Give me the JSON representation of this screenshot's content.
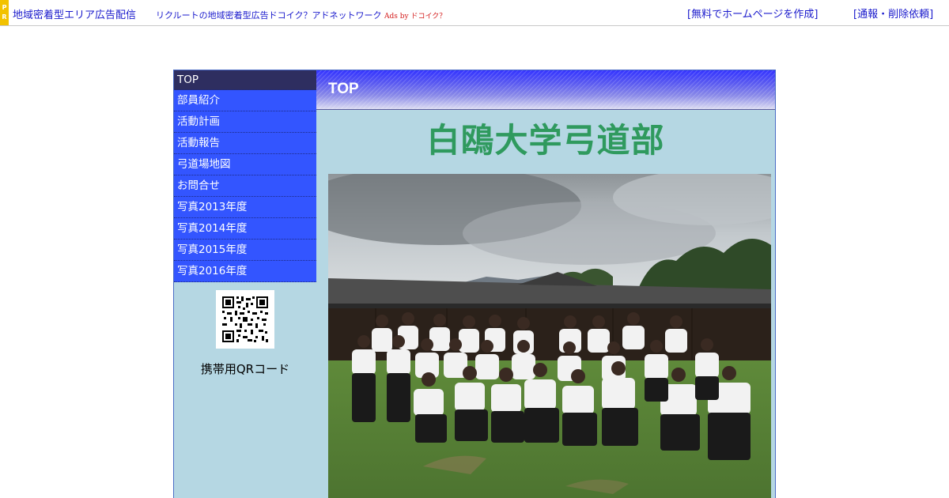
{
  "adbar": {
    "pr_letters": [
      "P",
      "R"
    ],
    "main_link": "地域密着型エリア広告配信",
    "sub_link": "リクルートの地域密着型広告ドコイク？アドネットワーク",
    "ads_by": "Ads by ドコイク？",
    "right_link_1": "[無料でホームページを作成]",
    "right_link_2": "[通報・削除依頼]"
  },
  "sidebar": {
    "items": [
      {
        "label": "TOP",
        "active": true
      },
      {
        "label": "部員紹介"
      },
      {
        "label": "活動計画"
      },
      {
        "label": "活動報告"
      },
      {
        "label": "弓道場地図"
      },
      {
        "label": "お問合せ"
      },
      {
        "label": "写真2013年度"
      },
      {
        "label": "写真2014年度"
      },
      {
        "label": "写真2015年度"
      },
      {
        "label": "写真2016年度"
      }
    ],
    "qr_label": "携帯用QRコード"
  },
  "main": {
    "header_title": "TOP",
    "club_name": "白鴎大学弓道部"
  },
  "colors": {
    "nav_bg": "#3355ff",
    "nav_active_bg": "#2e2e60",
    "content_bg": "#b5d7e3",
    "title_green": "#2f9a5e",
    "link_blue": "#1a1acc"
  }
}
